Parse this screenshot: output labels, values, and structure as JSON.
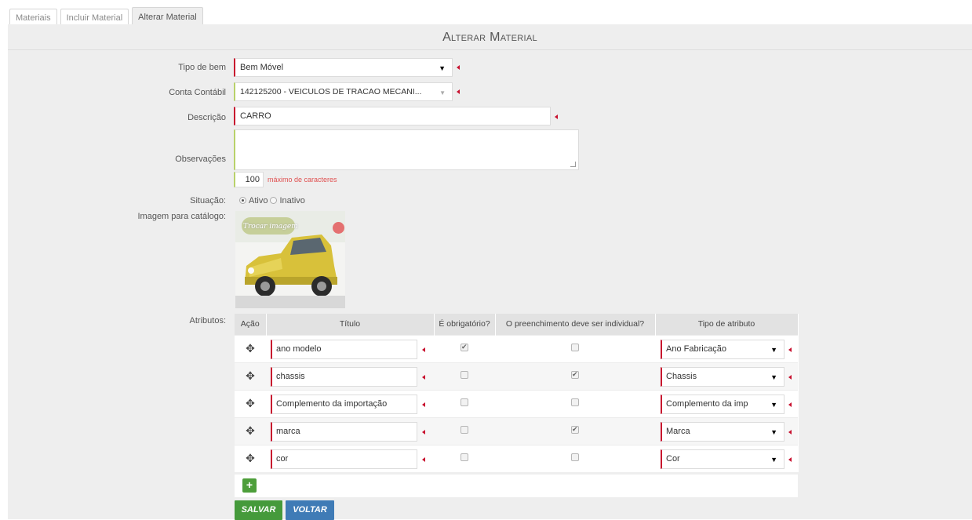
{
  "tabs": [
    {
      "label": "Materiais"
    },
    {
      "label": "Incluir Material"
    },
    {
      "label": "Alterar Material"
    }
  ],
  "header": {
    "title": "Alterar Material"
  },
  "form": {
    "tipo_bem": {
      "label": "Tipo de bem",
      "value": "Bem Móvel"
    },
    "conta_contabil": {
      "label": "Conta Contábil",
      "value": "142125200 - VEICULOS DE TRACAO MECANI..."
    },
    "descricao": {
      "label": "Descrição",
      "value": "CARRO"
    },
    "observacoes": {
      "label": "Observações",
      "value": "",
      "counter": "100",
      "counter_hint": "máximo de caracteres"
    },
    "situacao": {
      "label": "Situação:",
      "options": [
        "Ativo",
        "Inativo"
      ],
      "selected": "Ativo"
    },
    "imagem": {
      "label": "Imagem para catálogo:",
      "overlay_text": "Trocar imagem"
    },
    "atributos": {
      "label": "Atributos:",
      "columns": [
        "Ação",
        "Título",
        "É obrigatório?",
        "O preenchimento deve ser individual?",
        "Tipo de atributo"
      ],
      "rows": [
        {
          "titulo": "ano modelo",
          "obrigatorio": true,
          "individual": false,
          "tipo": "Ano Fabricação"
        },
        {
          "titulo": "chassis",
          "obrigatorio": false,
          "individual": true,
          "tipo": "Chassis"
        },
        {
          "titulo": "Complemento da importação",
          "obrigatorio": false,
          "individual": false,
          "tipo": "Complemento da imp"
        },
        {
          "titulo": "marca",
          "obrigatorio": false,
          "individual": true,
          "tipo": "Marca"
        },
        {
          "titulo": "cor",
          "obrigatorio": false,
          "individual": false,
          "tipo": "Cor"
        }
      ]
    }
  },
  "buttons": {
    "add": "+",
    "save": "SALVAR",
    "back": "VOLTAR"
  },
  "icons": {
    "move": "move-arrows-icon",
    "dropdown": "caret-down-icon",
    "required": "required-marker-icon"
  }
}
